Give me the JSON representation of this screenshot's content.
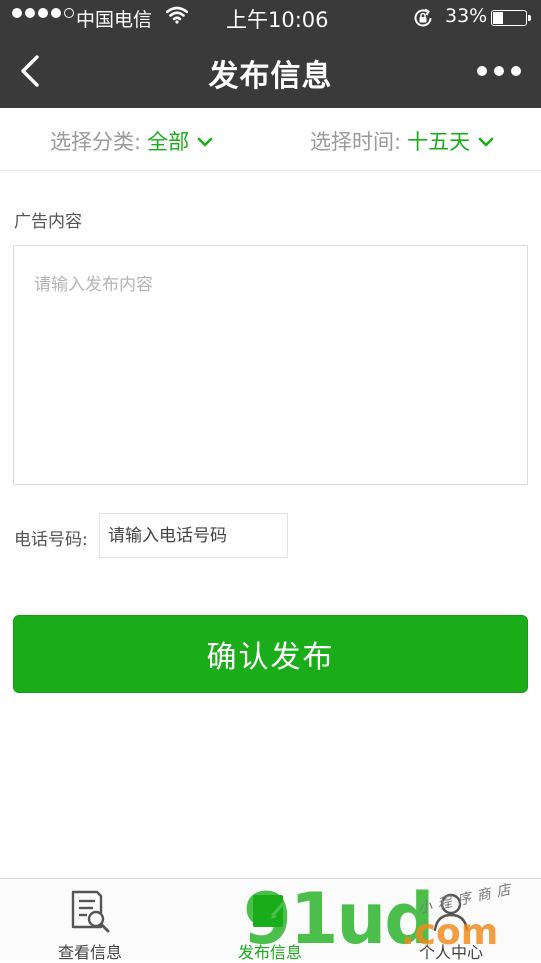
{
  "status_bar": {
    "carrier": "中国电信",
    "time": "上午10:06",
    "battery_pct": "33%",
    "battery_level": 0.33,
    "signal_bars": 5,
    "signal_filled": 4
  },
  "nav": {
    "title": "发布信息",
    "back_icon": "chevron-left-icon",
    "more_icon": "more-dots-icon"
  },
  "filters": {
    "category_label": "选择分类:",
    "category_value": "全部",
    "time_label": "选择时间:",
    "time_value": "十五天"
  },
  "form": {
    "ad_label": "广告内容",
    "content_placeholder": "请输入发布内容",
    "phone_label": "电话号码:",
    "phone_placeholder": "请输入电话号码",
    "submit_label": "确认发布"
  },
  "tabbar": {
    "tabs": [
      {
        "label": "查看信息",
        "icon": "document-search-icon",
        "active": false
      },
      {
        "label": "发布信息",
        "icon": "edit-icon",
        "active": true
      },
      {
        "label": "个人中心",
        "icon": "user-icon",
        "active": false
      }
    ]
  },
  "watermark": {
    "main": "91ud",
    "suffix": ".com",
    "tagline": "小程序商店"
  },
  "colors": {
    "accent": "#1aad19",
    "header_bg": "#3a3a3a",
    "watermark_orange": "#ee8c1e"
  }
}
